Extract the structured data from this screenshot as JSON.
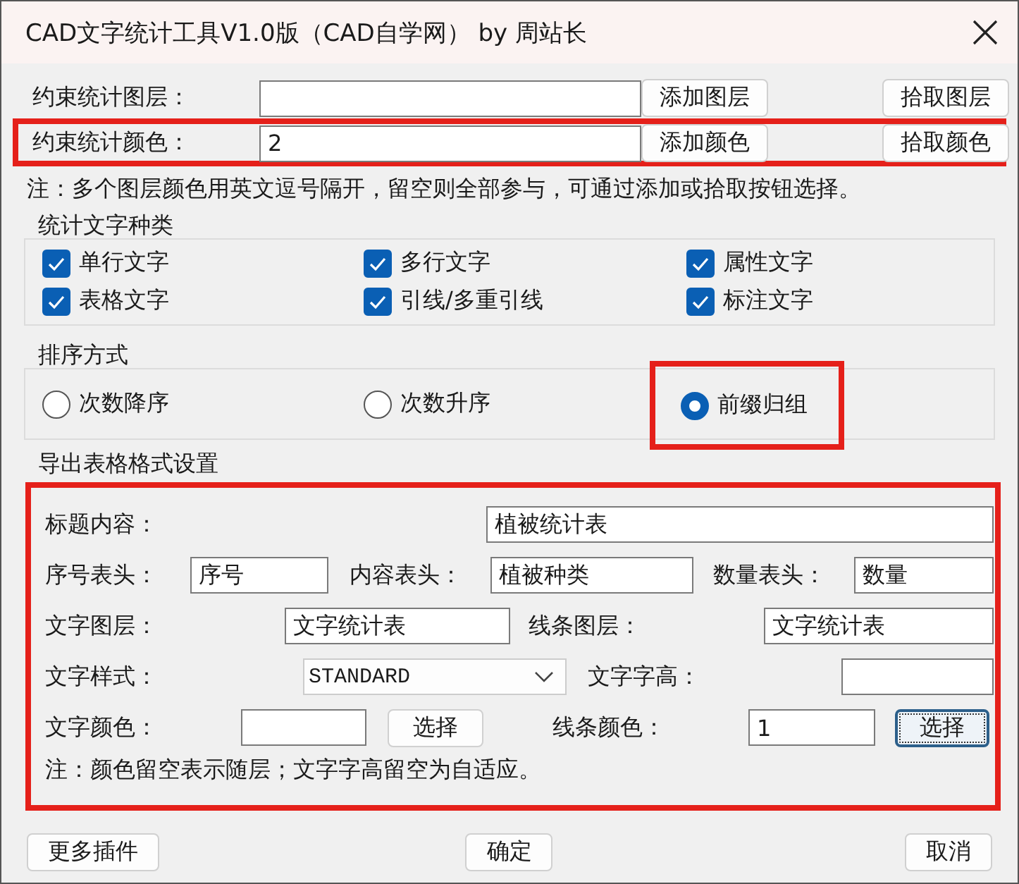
{
  "window": {
    "title": "CAD文字统计工具V1.0版（CAD自学网） by 周站长"
  },
  "constraints": [
    {
      "label": "约束统计图层：",
      "buttons": [
        "添加图层",
        "拾取图层"
      ],
      "highlighted": false
    },
    {
      "label": "约束统计颜色：",
      "value": "2",
      "buttons": [
        "添加颜色",
        "拾取颜色"
      ],
      "highlighted": true
    }
  ],
  "note": "注：多个图层颜色用英文逗号隔开，留空则全部参与，可通过添加或拾取按钮选择。",
  "text_types": {
    "title": "统计文字种类",
    "items": [
      {
        "label": "单行文字",
        "checked": true
      },
      {
        "label": "多行文字",
        "checked": true
      },
      {
        "label": "属性文字",
        "checked": true
      },
      {
        "label": "表格文字",
        "checked": true
      },
      {
        "label": "引线/多重引线",
        "checked": true
      },
      {
        "label": "标注文字",
        "checked": true
      }
    ]
  },
  "sort": {
    "title": "排序方式",
    "options": [
      {
        "label": "次数降序",
        "selected": false,
        "highlighted": false
      },
      {
        "label": "次数升序",
        "selected": false,
        "highlighted": false
      },
      {
        "label": "前缀归组",
        "selected": true,
        "highlighted": true
      }
    ]
  },
  "export": {
    "title": "导出表格格式设置",
    "highlighted": true,
    "rows": [
      [
        {
          "kind": "label",
          "text": "标题内容："
        },
        {
          "kind": "field",
          "value": "植被统计表"
        }
      ],
      [
        {
          "kind": "label",
          "text": "序号表头："
        },
        {
          "kind": "field",
          "value": "序号"
        },
        {
          "kind": "label",
          "text": "内容表头："
        },
        {
          "kind": "field",
          "value": "植被种类"
        },
        {
          "kind": "label",
          "text": "数量表头："
        },
        {
          "kind": "field",
          "value": "数量"
        }
      ],
      [
        {
          "kind": "label",
          "text": "文字图层："
        },
        {
          "kind": "field",
          "value": "文字统计表"
        },
        {
          "kind": "label",
          "text": "线条图层："
        },
        {
          "kind": "field",
          "value": "文字统计表"
        }
      ],
      [
        {
          "kind": "label",
          "text": "文字样式："
        },
        {
          "kind": "dropdown",
          "value": "STANDARD"
        },
        {
          "kind": "label",
          "text": "文字字高："
        },
        {
          "kind": "field"
        }
      ],
      [
        {
          "kind": "label",
          "text": "文字颜色："
        },
        {
          "kind": "field"
        },
        {
          "kind": "button",
          "label": "选择",
          "focused": false
        },
        {
          "kind": "label",
          "text": "线条颜色："
        },
        {
          "kind": "field",
          "value": "1"
        },
        {
          "kind": "button",
          "label": "选择",
          "focused": true
        }
      ]
    ],
    "note": "注：颜色留空表示随层；文字字高留空为自适应。"
  },
  "buttons": [
    "更多插件",
    "确定",
    "取消"
  ]
}
